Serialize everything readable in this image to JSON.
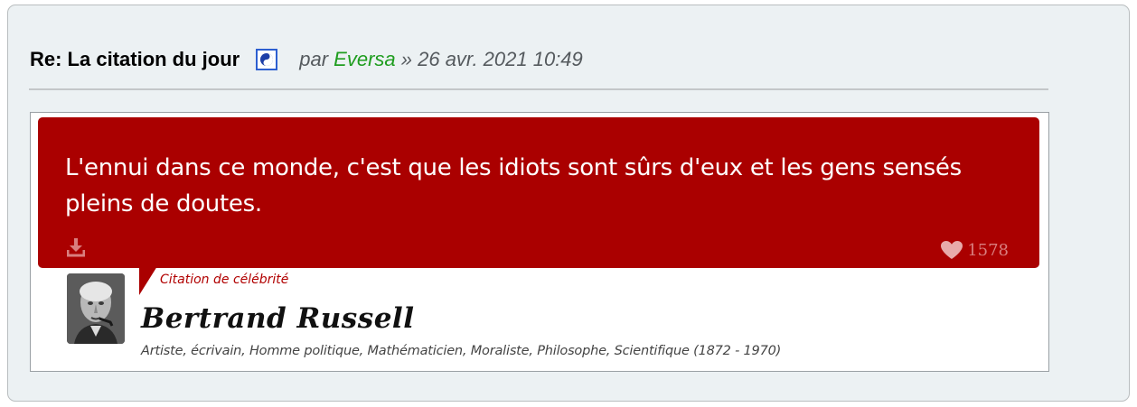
{
  "post": {
    "title": "Re: La citation du jour",
    "by_prefix": "par",
    "author": "Eversa",
    "separator_date": "» 26 avr. 2021 10:49",
    "icon": "post-type-icon"
  },
  "quote": {
    "text": "L'ennui dans ce monde, c'est que les idiots sont sûrs d'eux et les gens sensés pleins de doutes.",
    "likes": "1578",
    "download_icon": "download-icon",
    "like_icon": "heart-icon",
    "category": "Citation de célébrité",
    "person_name": "Bertrand Russell",
    "person_description": "Artiste, écrivain, Homme politique, Mathématicien, Moraliste, Philosophe, Scientifique (1872 - 1970)"
  },
  "colors": {
    "post_background": "#ecf1f3",
    "quote_background": "#aa0000",
    "author_link": "#1f9d1f",
    "meta_text": "#555a5e"
  }
}
